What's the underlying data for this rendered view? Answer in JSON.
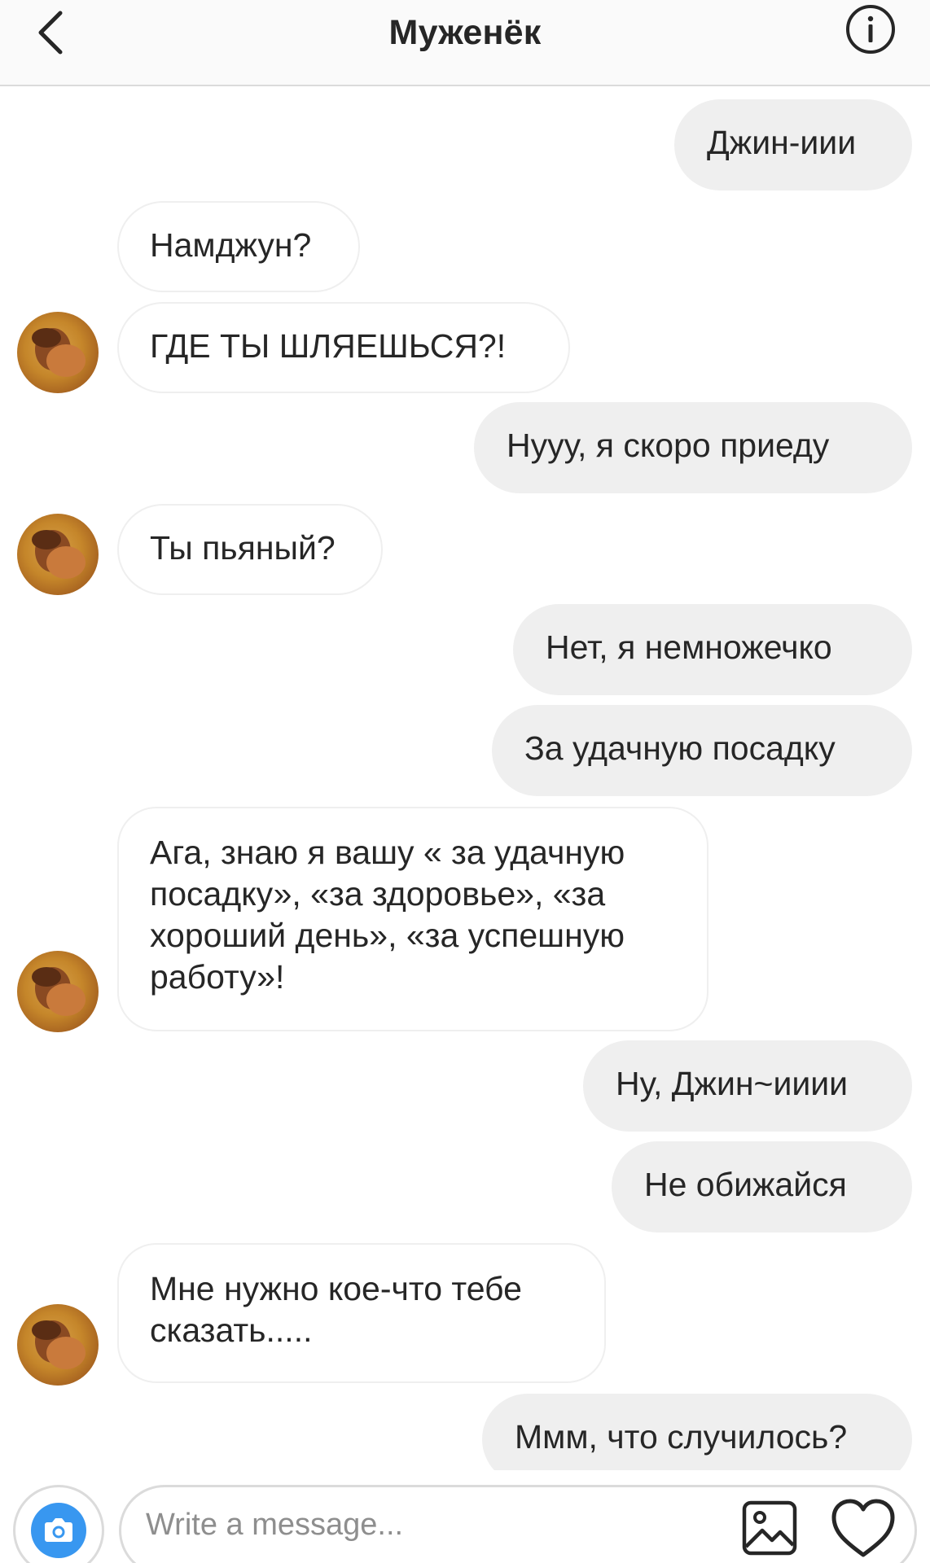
{
  "header": {
    "title": "Муженёк",
    "back_icon": "chevron-left-icon",
    "info_icon": "info-icon"
  },
  "messages": [
    {
      "side": "out",
      "text": "Джин-иии"
    },
    {
      "side": "in",
      "text": "Намджун?"
    },
    {
      "side": "in",
      "text": "ГДЕ ТЫ ШЛЯЕШЬСЯ?!",
      "avatar": true
    },
    {
      "side": "out",
      "text": "Нууу, я скоро приеду"
    },
    {
      "side": "in",
      "text": "Ты пьяный?",
      "avatar": true
    },
    {
      "side": "out",
      "text": "Нет, я немножечко"
    },
    {
      "side": "out",
      "text": "За удачную посадку"
    },
    {
      "side": "in",
      "text": "Ага, знаю я вашу « за удачную посадку», «за здоровье», «за хороший день», «за успешную работу»!",
      "avatar": true
    },
    {
      "side": "out",
      "text": "Ну, Джин~ииии"
    },
    {
      "side": "out",
      "text": "Не обижайся"
    },
    {
      "side": "in",
      "text": "Мне нужно кое-что тебе сказать.....",
      "avatar": true
    },
    {
      "side": "out",
      "text": "Ммм, что случилось?"
    }
  ],
  "composer": {
    "placeholder": "Write a message...",
    "value": "",
    "camera_icon": "camera-icon",
    "gallery_icon": "gallery-icon",
    "heart_icon": "heart-icon",
    "accent_color": "#3897f0"
  }
}
